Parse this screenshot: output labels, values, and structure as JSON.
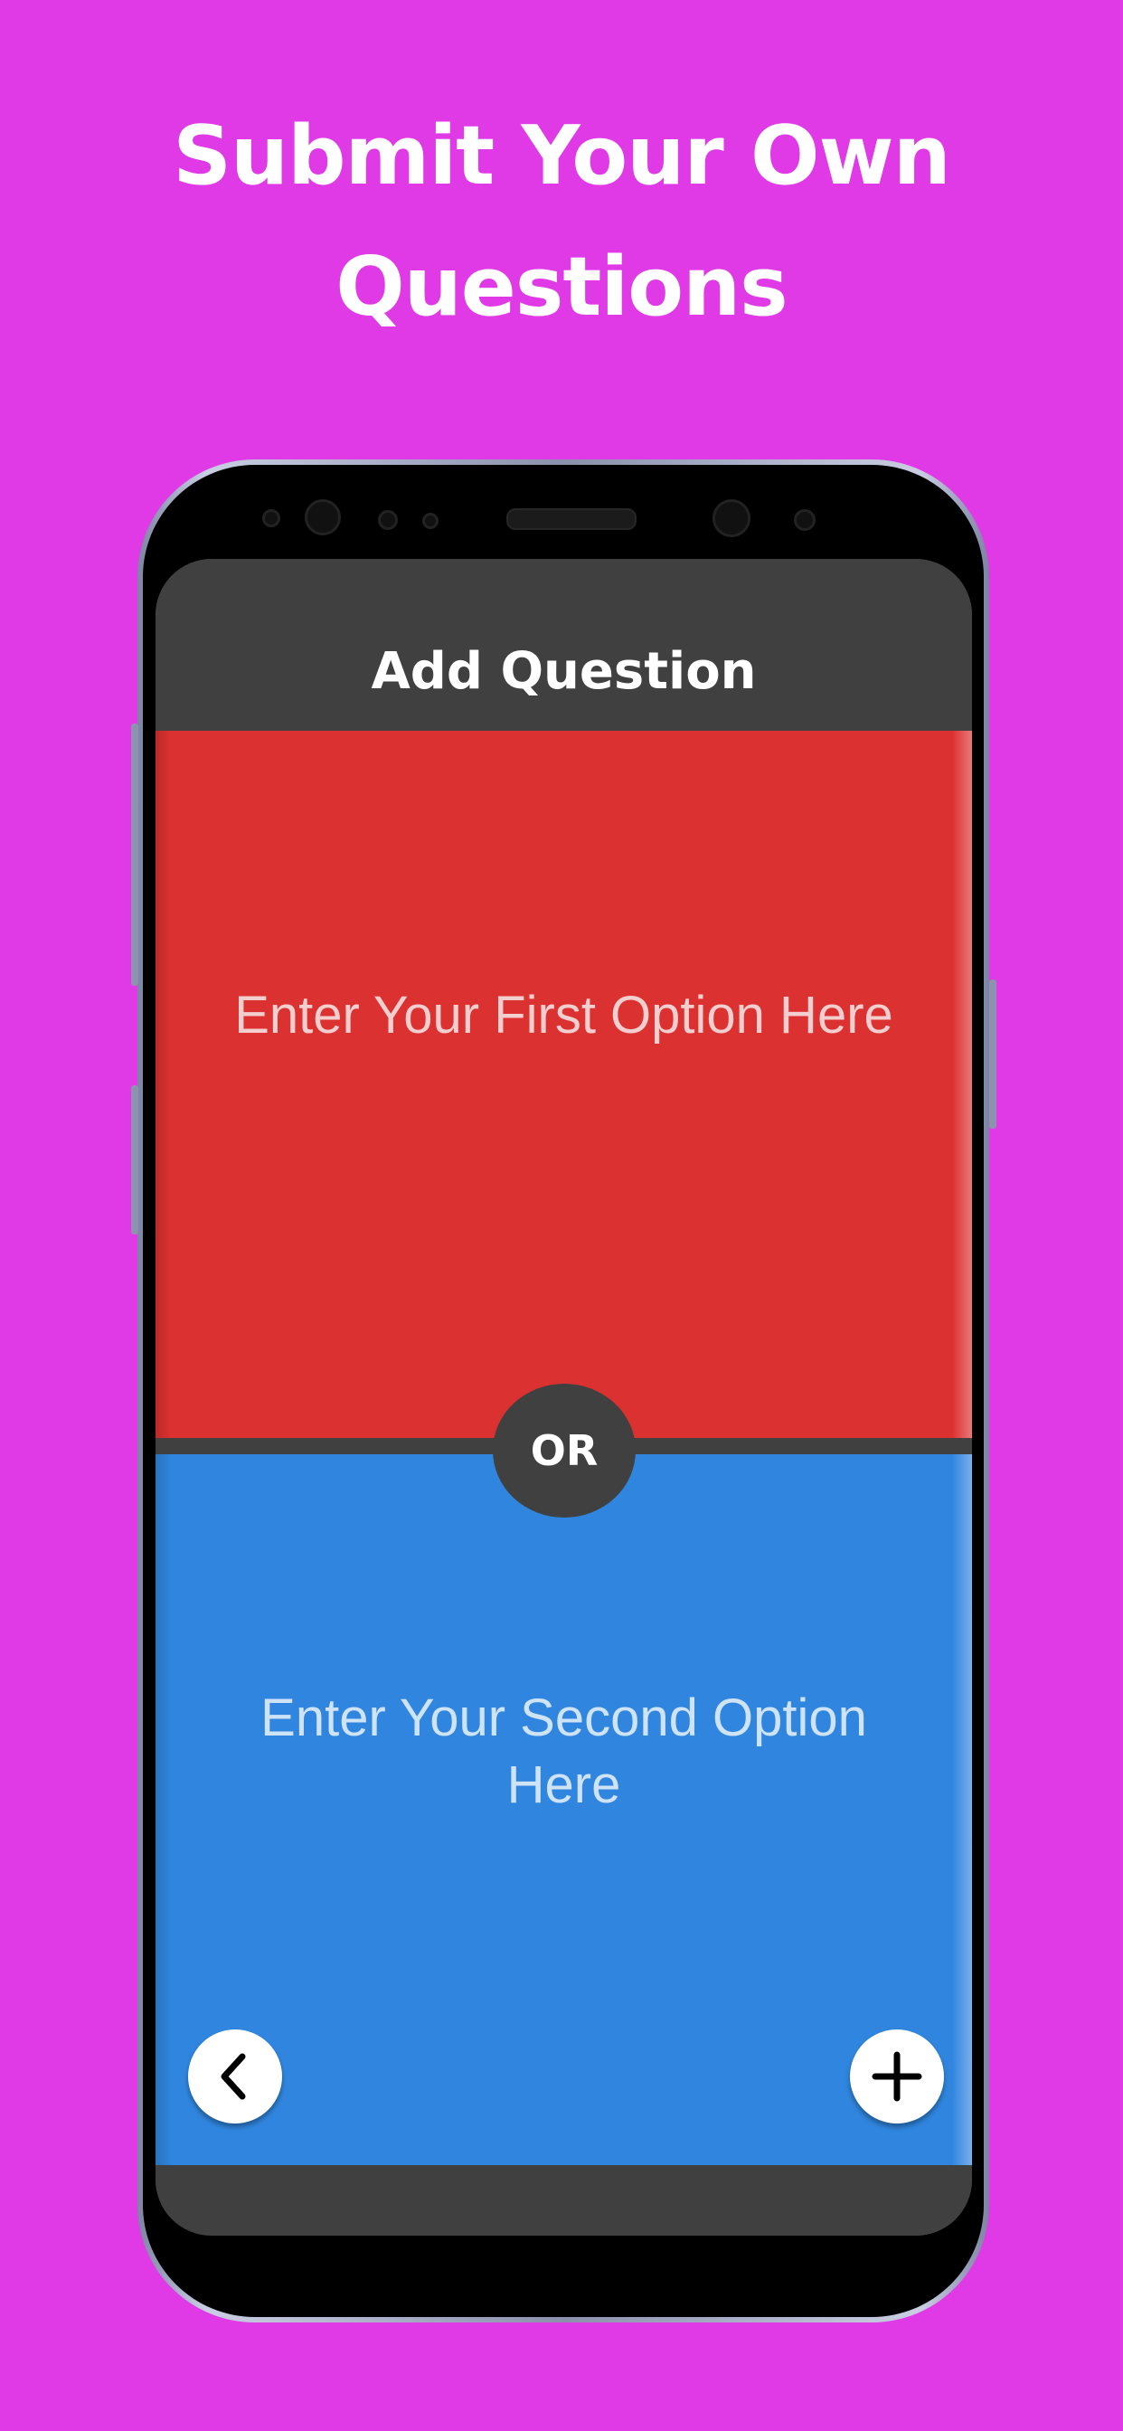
{
  "promo": {
    "headline_line1": "Submit Your Own",
    "headline_line2": "Questions"
  },
  "app": {
    "header_title": "Add Question",
    "first_option_placeholder": "Enter Your First Option Here",
    "second_option_placeholder": "Enter Your Second Option Here",
    "divider_label": "OR"
  },
  "controls": {
    "back_icon": "chevron-left-icon",
    "add_icon": "plus-icon"
  },
  "colors": {
    "background": "#e03ae6",
    "first_option": "#dc3131",
    "second_option": "#3086df",
    "header": "#404040"
  }
}
